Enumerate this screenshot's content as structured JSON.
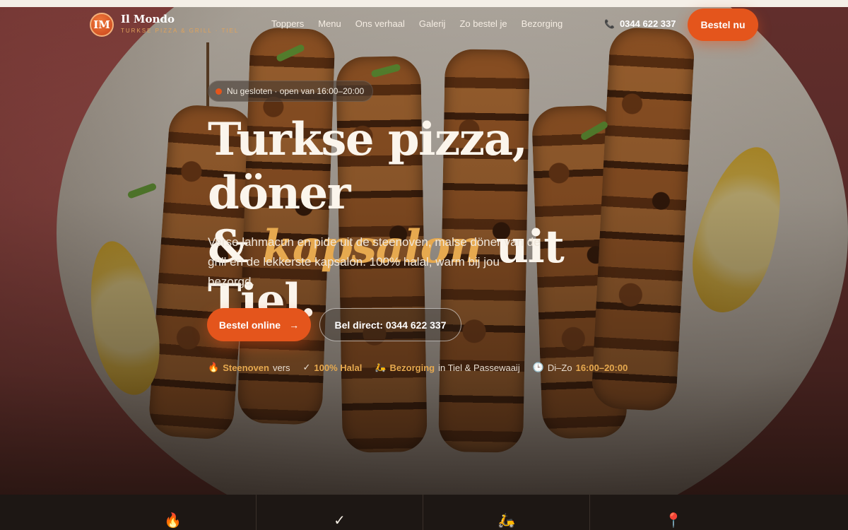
{
  "brand": {
    "badge": "IM",
    "name": "Il Mondo",
    "tagline": "TURKSE PIZZA & GRILL · TIEL"
  },
  "nav": {
    "links": [
      "Toppers",
      "Menu",
      "Ons verhaal",
      "Galerij",
      "Zo bestel je",
      "Bezorging"
    ],
    "phone_icon": "phone-icon",
    "phone": "0344 622 337",
    "cta": "Bestel nu"
  },
  "hero": {
    "status": "Nu gesloten · open van 16:00–20:00",
    "headline_line1": "Turkse pizza, döner",
    "headline_amp": "&",
    "headline_accent": "kapsalon",
    "headline_end": "uit Tiel.",
    "lede": "Verse lahmacun en pide uit de steenoven, malse döner van de grill en de lekkerste kapsalon. 100% halal, warm bij jou bezorgd.",
    "primary_cta": "Bestel online",
    "primary_arrow": "→",
    "secondary_cta": "Bel direct: 0344 622 337"
  },
  "features": [
    {
      "icon": "🔥",
      "highlight": "Steenoven",
      "text": "vers"
    },
    {
      "icon": "✓",
      "highlight": "100% Halal",
      "text": ""
    },
    {
      "icon": "🛵",
      "highlight": "Bezorging",
      "text": "in Tiel & Passewaaij"
    },
    {
      "icon": "🕒",
      "text_before": "Di–Zo",
      "highlight": "16:00–20:00"
    }
  ],
  "bottom_icons": [
    "🔥",
    "✓",
    "🛵",
    "📍"
  ],
  "colors": {
    "accent": "#e4551c",
    "gold": "#e6a94f",
    "dark": "#1d1714"
  }
}
